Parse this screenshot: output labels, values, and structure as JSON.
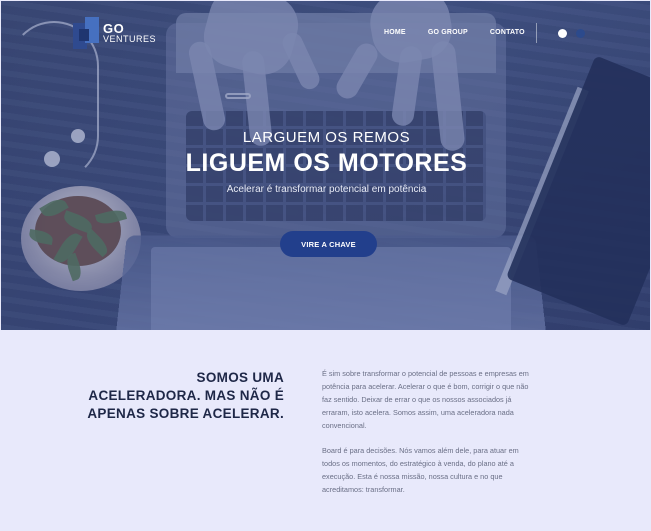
{
  "brand": {
    "go": "GO",
    "ventures": "VENTURES"
  },
  "nav": {
    "items": [
      "HOME",
      "GO GROUP",
      "CONTATO"
    ]
  },
  "hero": {
    "kicker": "LARGUEM OS REMOS",
    "headline": "LIGUEM OS MOTORES",
    "subheadline": "Acelerar é transformar potencial em potência",
    "cta_label": "VIRE A CHAVE"
  },
  "about": {
    "title": "SOMOS UMA ACELERADORA. MAS NÃO É APENAS SOBRE ACELERAR.",
    "paragraph1": "É sim sobre transformar o potencial de pessoas e empresas em potência para acelerar. Acelerar o que é bom, corrigir o que não faz sentido. Deixar de errar o que os nossos associados já erraram, isto acelera. Somos assim, uma aceleradora nada convencional.",
    "paragraph2": "Board é para decisões. Nós vamos além dele, para atuar em todos os momentos, do estratégico à venda, do plano até a execução. Esta é nossa missão, nossa cultura e no que acreditamos: transformar."
  },
  "colors": {
    "accent": "#223f8c",
    "background": "#e8e9fb",
    "title": "#1e2747",
    "body_text": "#6a6f86"
  }
}
